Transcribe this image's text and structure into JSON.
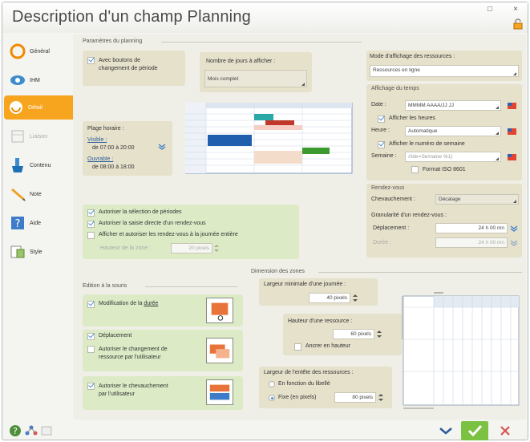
{
  "window": {
    "title": "Description d'un champ Planning",
    "minimize_glyph": "□",
    "close_glyph": "×"
  },
  "sidebar": {
    "items": [
      {
        "label": "Général",
        "icon": "general-icon"
      },
      {
        "label": "IHM",
        "icon": "ihm-icon"
      },
      {
        "label": "Détail",
        "icon": "detail-icon",
        "active": true
      },
      {
        "label": "Liaison",
        "icon": "liaison-icon",
        "disabled": true
      },
      {
        "label": "Contenu",
        "icon": "contenu-icon"
      },
      {
        "label": "Note",
        "icon": "note-icon"
      },
      {
        "label": "Aide",
        "icon": "aide-icon"
      },
      {
        "label": "Style",
        "icon": "style-icon"
      }
    ]
  },
  "params": {
    "section_title": "Paramètres du planning",
    "buttons_change_period": "Avec boutons de\nchangement de période",
    "days_label": "Nombre de jours à afficher :",
    "days_value": "Mois complet",
    "plage_label": "Plage horaire :",
    "visible_label": "Visible :",
    "visible_value": "de 07:00 à 20:00",
    "ouvrable_label": "Ouvrable :",
    "ouvrable_value": "de 08:00 à 18:00",
    "options": [
      {
        "label": "Autoriser la sélection de périodes",
        "checked": true
      },
      {
        "label": "Autoriser la saisie directe d'un rendez-vous",
        "checked": true
      },
      {
        "label": "Afficher et autoriser les rendez-vous à la journée entière",
        "checked": false
      }
    ],
    "hauteur_zone_label": "Hauteur de la zone :",
    "hauteur_zone_value": "20 pixels"
  },
  "resources_mode": {
    "label": "Mode d'affichage des ressources :",
    "value": "Ressources en ligne"
  },
  "time_display": {
    "section_title": "Affichage du temps",
    "date_label": "Date :",
    "date_value": "MMMM AAAA/JJ JJ",
    "show_hours_label": "Afficher les heures",
    "heure_label": "Heure :",
    "heure_value": "Automatique",
    "show_week_label": "Afficher le numéro de semaine",
    "semaine_label": "Semaine :",
    "semaine_value": "//Ide=Semaine %1)",
    "iso_label": "Format ISO 8601"
  },
  "rdv": {
    "section_title": "Rendez-vous",
    "chevauchement_label": "Chevauchement :",
    "chevauchement_value": "Décalage",
    "granularite_label": "Granularité d'un rendez-vous :",
    "deplacement_label": "Déplacement :",
    "deplacement_value": "24 h 00 mn",
    "duree_label": "Durée :",
    "duree_value": "24 h 00 mn"
  },
  "mouse": {
    "section_title": "Edition à la souris",
    "duree_prefix": "Modification de la ",
    "duree_word": "durée",
    "deplacement_label": "Déplacement",
    "change_resource_label": "Autoriser le changement de\nressource par l'utilisateur",
    "chevauchement_label": "Autoriser le chevauchement\npar l'utilisateur"
  },
  "zones": {
    "section_title": "Dimension des zones",
    "min_width_label": "Largeur minimale d'une journée :",
    "min_width_value": "40 pixels",
    "resource_height_label": "Hauteur d'une ressource :",
    "resource_height_value": "60 pixels",
    "anchor_label": "Ancrer en hauteur",
    "header_width_label": "Largeur de l'entête des ressources :",
    "by_label_option": "En fonction du libellé",
    "fixed_option": "Fixe (en pixels)",
    "fixed_value": "80 pixels"
  },
  "colors": {
    "accent": "#f7a51e",
    "panel_tan": "#e6e1cb",
    "panel_green": "#dcebc6",
    "ok_green": "#7cc242",
    "cancel_red": "#d9534f"
  }
}
